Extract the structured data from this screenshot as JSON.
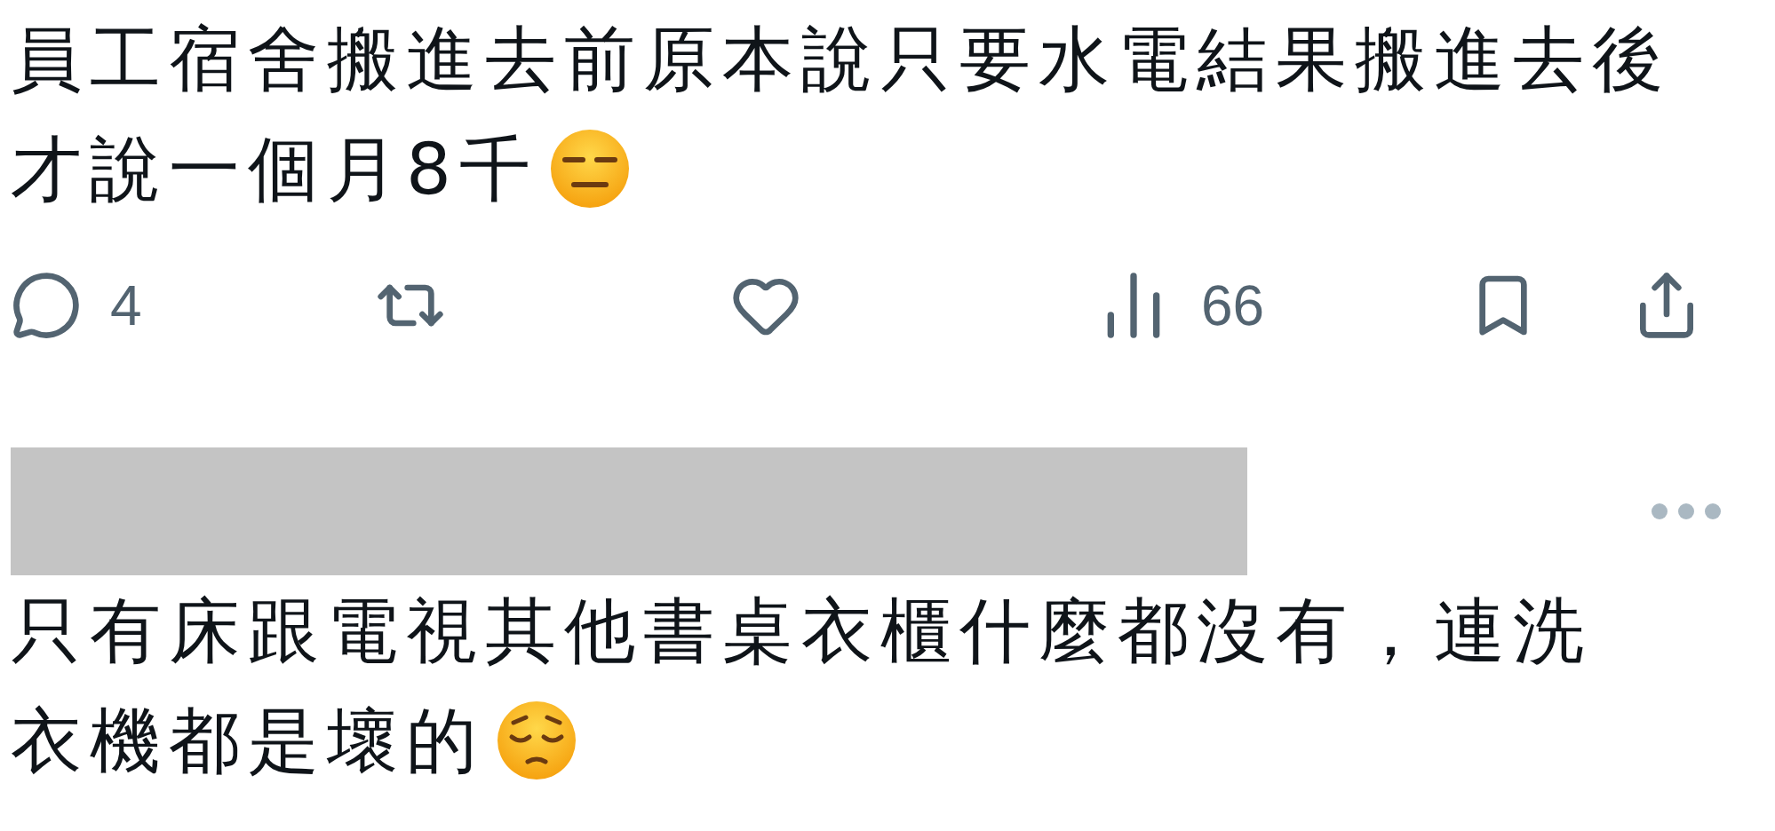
{
  "post": {
    "text_lines": [
      "員工宿舍搬進去前原本說只要水電結果搬進去後",
      "才說一個月8千"
    ],
    "emoji": {
      "kind": "expressionless"
    }
  },
  "actions": [
    {
      "kind": "reply",
      "count": "4"
    },
    {
      "kind": "repost"
    },
    {
      "kind": "like"
    },
    {
      "kind": "views",
      "count": "66"
    },
    {
      "kind": "bookmark"
    },
    {
      "kind": "share"
    }
  ],
  "reply": {
    "author": {
      "kind": "redacted"
    },
    "text_lines": [
      "只有床跟電視其他書桌衣櫃什麼都沒有，連洗",
      "衣機都是壞的"
    ],
    "emoji": {
      "kind": "pensive"
    }
  }
}
